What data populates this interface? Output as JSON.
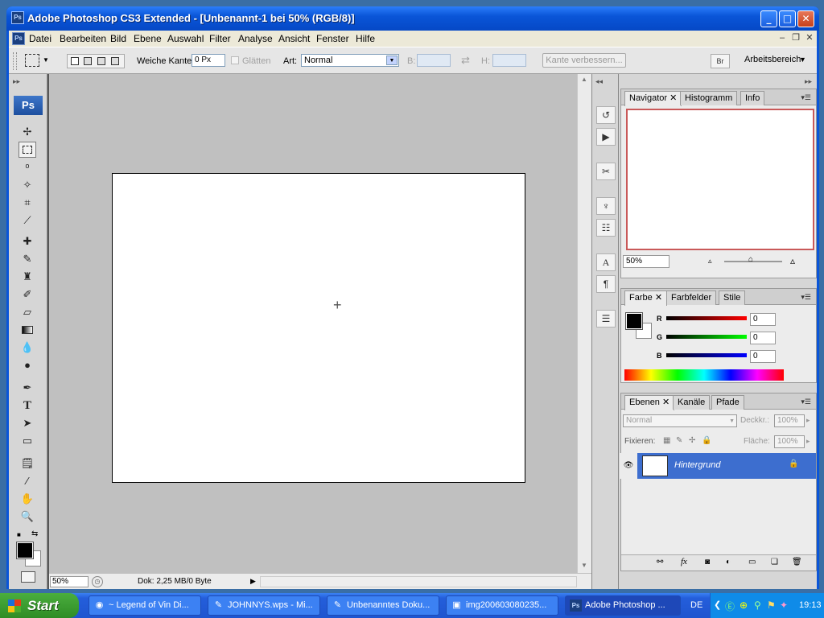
{
  "window": {
    "title": "Adobe Photoshop CS3 Extended - [Unbenannt-1 bei 50% (RGB/8)]",
    "icon": "Ps"
  },
  "menubar": {
    "items": [
      "Datei",
      "Bearbeiten",
      "Bild",
      "Ebene",
      "Auswahl",
      "Filter",
      "Analyse",
      "Ansicht",
      "Fenster",
      "Hilfe"
    ]
  },
  "options": {
    "feather_label": "Weiche Kante:",
    "feather_value": "0 Px",
    "antialias_label": "Glätten",
    "style_label": "Art:",
    "style_value": "Normal",
    "width_label": "B:",
    "height_label": "H:",
    "refine_label": "Kante verbessern...",
    "workspace_label": "Arbeitsbereich"
  },
  "tools": {
    "logo": "Ps"
  },
  "status": {
    "zoom": "50%",
    "doc": "Dok: 2,25 MB/0 Byte"
  },
  "navigator": {
    "tabs": [
      "Navigator",
      "Histogramm",
      "Info"
    ],
    "zoom": "50%"
  },
  "color": {
    "tabs": [
      "Farbe",
      "Farbfelder",
      "Stile"
    ],
    "r_label": "R",
    "g_label": "G",
    "b_label": "B",
    "r_value": "0",
    "g_value": "0",
    "b_value": "0",
    "foreground": "#000000",
    "background": "#ffffff"
  },
  "layers": {
    "tabs": [
      "Ebenen",
      "Kanäle",
      "Pfade"
    ],
    "blend_mode": "Normal",
    "opacity_label": "Deckkr.:",
    "opacity_value": "100%",
    "lock_label": "Fixieren:",
    "fill_label": "Fläche:",
    "fill_value": "100%",
    "layer_name": "Hintergrund"
  },
  "taskbar": {
    "start_label": "Start",
    "tasks": [
      "~ Legend of Vin Di...",
      "JOHNNYS.wps - Mi...",
      "Unbenanntes Doku...",
      "img200603080235...",
      "Adobe Photoshop ..."
    ],
    "lang": "DE",
    "clock": "19:13"
  }
}
